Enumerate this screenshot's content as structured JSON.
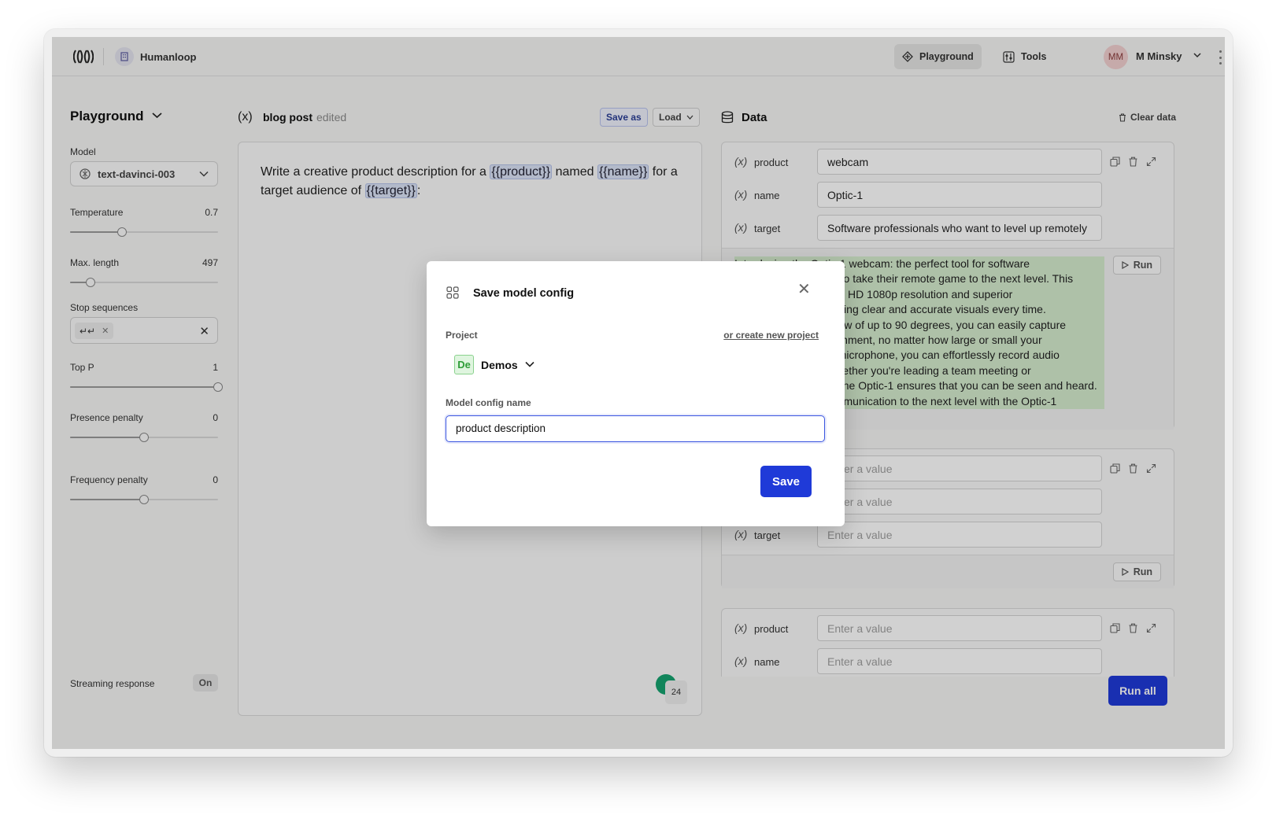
{
  "topbar": {
    "org_name": "Humanloop",
    "nav_playground": "Playground",
    "nav_tools": "Tools",
    "avatar_initials": "MM",
    "user_name": "M Minsky"
  },
  "sidebar": {
    "title": "Playground",
    "model_label": "Model",
    "model_value": "text-davinci-003",
    "temperature": {
      "label": "Temperature",
      "value": "0.7",
      "fraction": 0.35
    },
    "max_length": {
      "label": "Max. length",
      "value": "497",
      "fraction": 0.14
    },
    "stop_label": "Stop sequences",
    "stop_chip": "↵↵",
    "top_p": {
      "label": "Top P",
      "value": "1",
      "fraction": 1.0
    },
    "presence": {
      "label": "Presence penalty",
      "value": "0",
      "fraction": 0.5
    },
    "frequency": {
      "label": "Frequency penalty",
      "value": "0",
      "fraction": 0.5
    },
    "streaming_label": "Streaming response",
    "streaming_value": "On"
  },
  "editor": {
    "title": "blog post",
    "status": "edited",
    "save_as": "Save as",
    "load": "Load",
    "prompt_part1": "Write a creative product description for a ",
    "var_product": "{{product}}",
    "prompt_part2": " named ",
    "var_name": "{{name}}",
    "prompt_part3": " for a target audience of ",
    "var_target": "{{target}}",
    "prompt_part4": ":",
    "badge_count": "24"
  },
  "data": {
    "title": "Data",
    "clear": "Clear data",
    "var_symbol": "(x)",
    "placeholder": "Enter a value",
    "run": "Run",
    "run_all": "Run all",
    "card1": {
      "product_label": "product",
      "product_value": "webcam",
      "name_label": "name",
      "name_value": "Optic-1",
      "target_label": "target",
      "target_value": "Software professionals who want to level up remotely",
      "output_lines": [
        "Introducing the Optic-1 webcam: the perfect tool for software",
        "professionals looking to take their remote game to the next level. This",
        "webcam features a full HD 1080p resolution and superior",
        "lens technology, ensuring clear and accurate visuals every time.",
        "With a wide field of view of up to 90 degrees, you can easily capture",
        "all of your work environment, no matter how large or small your",
        "setup. With a built-in microphone, you can effortlessly record audio",
        "with crystal clarity. Whether you're leading a team meeting or",
        "a client engagement, the Optic-1 ensures that you can be seen and heard.",
        "Take your remote communication to the next level with the Optic-1"
      ]
    },
    "card2": {
      "target_label": "target"
    },
    "card3": {
      "product_label": "product",
      "name_label": "name"
    }
  },
  "modal": {
    "title": "Save model config",
    "project_label": "Project",
    "create_link": "or create new project",
    "project_badge": "De",
    "project_name": "Demos",
    "config_name_label": "Model config name",
    "config_name_value": "product description",
    "save": "Save"
  },
  "colors": {
    "accent": "#1f3ad8",
    "output_highlight": "#d5ecce",
    "variable_chip": "#dbe3f7"
  }
}
